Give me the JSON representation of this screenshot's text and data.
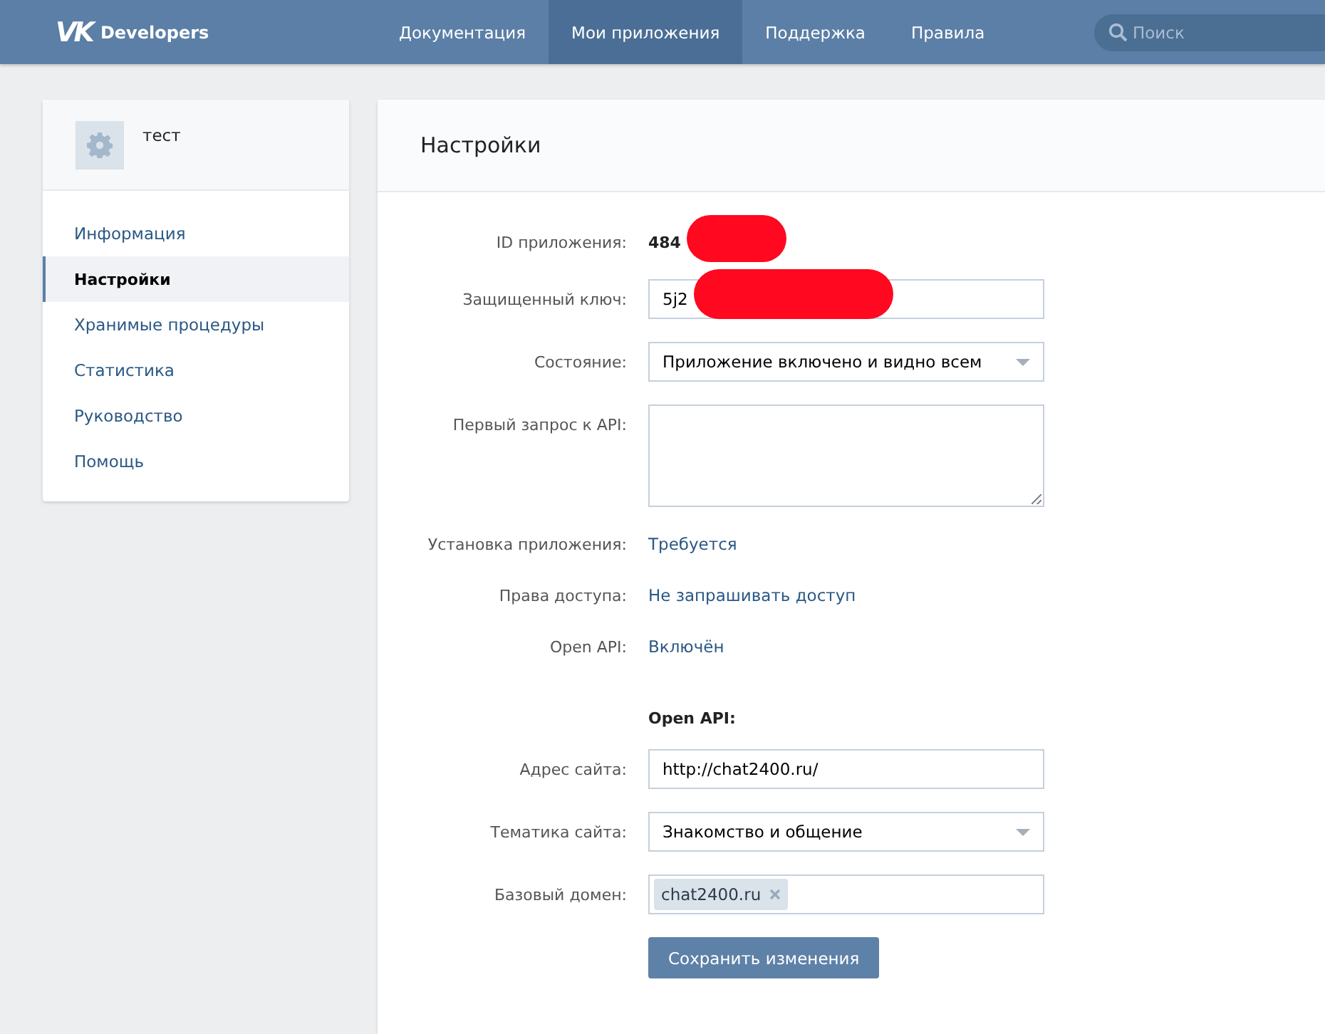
{
  "header": {
    "logo_mark": "VK",
    "brand": "Developers",
    "nav": [
      {
        "label": "Документация",
        "selected": false
      },
      {
        "label": "Мои приложения",
        "selected": true
      },
      {
        "label": "Поддержка",
        "selected": false
      },
      {
        "label": "Правила",
        "selected": false
      }
    ],
    "search": {
      "placeholder": "Поиск"
    }
  },
  "app": {
    "name": "тест"
  },
  "sidebar": {
    "items": [
      {
        "label": "Информация",
        "selected": false
      },
      {
        "label": "Настройки",
        "selected": true
      },
      {
        "label": "Хранимые процедуры",
        "selected": false
      },
      {
        "label": "Статистика",
        "selected": false
      },
      {
        "label": "Руководство",
        "selected": false
      },
      {
        "label": "Помощь",
        "selected": false
      }
    ]
  },
  "panel": {
    "title": "Настройки",
    "rows": [
      {
        "kind": "value",
        "label": "ID приложения:",
        "value": "484",
        "redacted": true
      },
      {
        "kind": "input",
        "label": "Защищенный ключ:",
        "value": "5j2",
        "redacted": true
      },
      {
        "kind": "select",
        "label": "Состояние:",
        "value": "Приложение включено и видно всем"
      },
      {
        "kind": "textarea",
        "label": "Первый запрос к API:"
      },
      {
        "kind": "link",
        "label": "Установка приложения:",
        "value": "Требуется"
      },
      {
        "kind": "link",
        "label": "Права доступа:",
        "value": "Не запрашивать доступ"
      },
      {
        "kind": "link",
        "label": "Open API:",
        "value": "Включён"
      },
      {
        "kind": "heading",
        "value": "Open API:"
      },
      {
        "kind": "input",
        "label": "Адрес сайта:",
        "value": "http://chat2400.ru/"
      },
      {
        "kind": "select",
        "label": "Тематика сайта:",
        "value": "Знакомство и общение"
      },
      {
        "kind": "tags",
        "label": "Базовый домен:",
        "tags": [
          "chat2400.ru"
        ]
      }
    ],
    "save_button": "Сохранить изменения"
  }
}
